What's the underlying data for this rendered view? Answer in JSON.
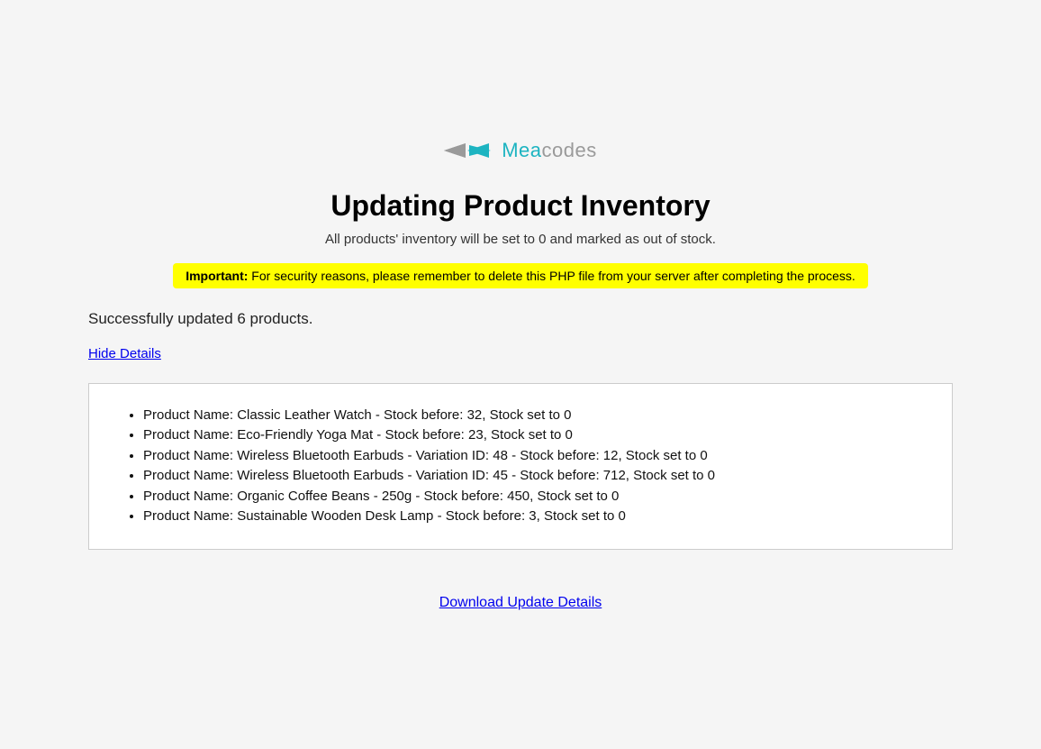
{
  "logo": {
    "prefix": "Mea",
    "suffix": "codes"
  },
  "header": {
    "title": "Updating Product Inventory",
    "subtitle": "All products' inventory will be set to 0 and marked as out of stock."
  },
  "warning": {
    "label": "Important:",
    "message": " For security reasons, please remember to delete this PHP file from your server after completing the process."
  },
  "success": {
    "message": "Successfully updated 6 products."
  },
  "toggle": {
    "hide_label": "Hide Details"
  },
  "details": {
    "items": [
      "Product Name: Classic Leather Watch - Stock before: 32, Stock set to 0",
      "Product Name: Eco-Friendly Yoga Mat - Stock before: 23, Stock set to 0",
      "Product Name: Wireless Bluetooth Earbuds - Variation ID: 48 - Stock before: 12, Stock set to 0",
      "Product Name: Wireless Bluetooth Earbuds - Variation ID: 45 - Stock before: 712, Stock set to 0",
      "Product Name: Organic Coffee Beans - 250g - Stock before: 450, Stock set to 0",
      "Product Name: Sustainable Wooden Desk Lamp - Stock before: 3, Stock set to 0"
    ]
  },
  "download": {
    "label": "Download Update Details"
  }
}
